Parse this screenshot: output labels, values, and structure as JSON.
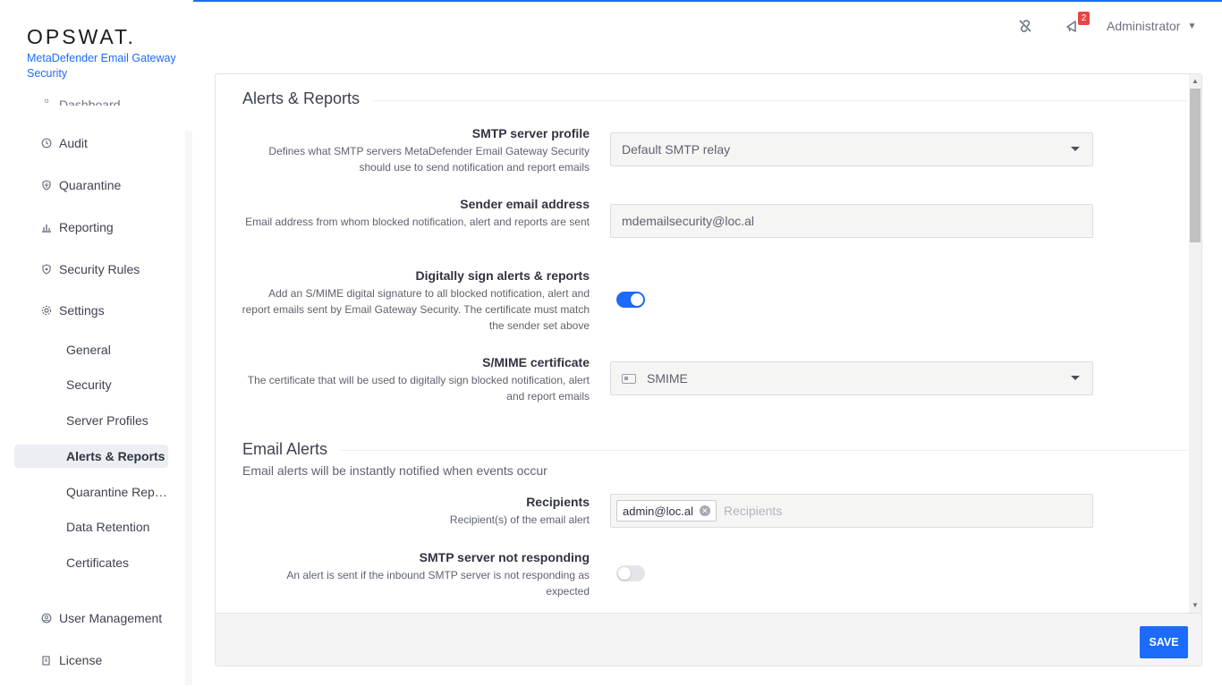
{
  "app": {
    "logo": "OPSWAT.",
    "product": "MetaDefender Email Gateway Security"
  },
  "header": {
    "notification_count": "2",
    "user": "Administrator"
  },
  "sidebar": {
    "cut_item": "Dashboard",
    "items": [
      {
        "label": "Audit",
        "icon": "clock-icon"
      },
      {
        "label": "Quarantine",
        "icon": "shield-icon"
      },
      {
        "label": "Reporting",
        "icon": "chart-icon"
      },
      {
        "label": "Security Rules",
        "icon": "shield-check-icon"
      },
      {
        "label": "Settings",
        "icon": "gear-icon"
      }
    ],
    "settings_sub": [
      "General",
      "Security",
      "Server Profiles",
      "Alerts & Reports",
      "Quarantine Rep…",
      "Data Retention",
      "Certificates"
    ],
    "bottom_items": [
      {
        "label": "User Management",
        "icon": "user-circle-icon"
      },
      {
        "label": "License",
        "icon": "license-icon"
      }
    ]
  },
  "main": {
    "alerts_title": "Alerts & Reports",
    "smtp_profile": {
      "label": "SMTP server profile",
      "desc": "Defines what SMTP servers MetaDefender Email Gateway Security should use to send notification and report emails",
      "value": "Default SMTP relay"
    },
    "sender": {
      "label": "Sender email address",
      "desc": "Email address from whom blocked notification, alert and reports are sent",
      "value": "mdemailsecurity@loc.al"
    },
    "sign": {
      "label": "Digitally sign alerts & reports",
      "desc": "Add an S/MIME digital signature to all blocked notification, alert and report emails sent by Email Gateway Security. The certificate must match the sender set above",
      "enabled": true
    },
    "smime": {
      "label": "S/MIME certificate",
      "desc": "The certificate that will be used to digitally sign blocked notification, alert and report emails",
      "value": "SMIME"
    },
    "email_alerts_title": "Email Alerts",
    "email_alerts_sub": "Email alerts will be instantly notified when events occur",
    "recipients": {
      "label": "Recipients",
      "desc": "Recipient(s) of the email alert",
      "chip": "admin@loc.al",
      "placeholder": "Recipients"
    },
    "smtp_not_responding": {
      "label": "SMTP server not responding",
      "desc": "An alert is sent if the inbound SMTP server is not responding as expected",
      "enabled": false
    }
  },
  "footer": {
    "save_label": "SAVE"
  },
  "colors": {
    "accent": "#1d6bfc",
    "badge": "#e64545"
  }
}
